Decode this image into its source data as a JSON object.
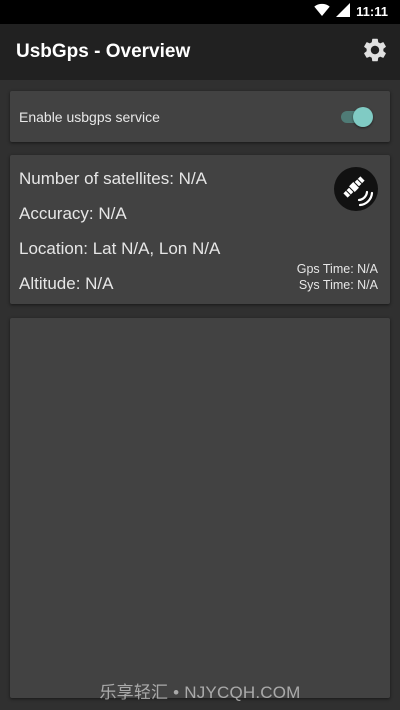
{
  "status_bar": {
    "time": "11:11",
    "wifi_icon": "wifi-icon",
    "signal_icon": "cell-signal-icon"
  },
  "app_bar": {
    "title": "UsbGps - Overview",
    "settings_icon": "gear-icon"
  },
  "service_toggle": {
    "label": "Enable usbgps service",
    "enabled": true,
    "accent_color": "#80cbc4"
  },
  "gps_info": {
    "satellites": "Number of satellites: N/A",
    "accuracy": "Accuracy: N/A",
    "location": "Location: Lat N/A, Lon N/A",
    "altitude": "Altitude: N/A",
    "gps_time": "Gps Time: N/A",
    "sys_time": "Sys Time: N/A",
    "status_icon": "satellite-icon"
  },
  "watermark": "乐享轻汇 • NJYCQH.COM"
}
